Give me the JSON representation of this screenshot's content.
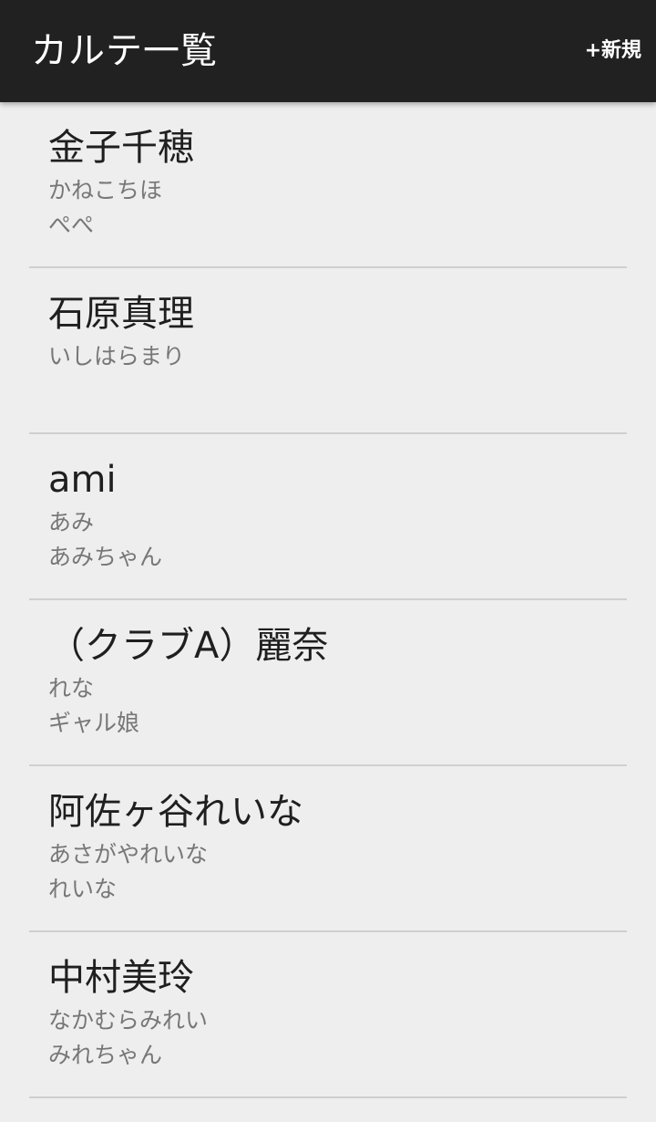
{
  "appbar": {
    "title": "カルテ一覧",
    "new_label": "+新規"
  },
  "records": [
    {
      "name": "金子千穂",
      "kana": "かねこちほ",
      "nickname": "ぺぺ"
    },
    {
      "name": "石原真理",
      "kana": "いしはらまり",
      "nickname": ""
    },
    {
      "name": "ami",
      "kana": "あみ",
      "nickname": "あみちゃん"
    },
    {
      "name": "（クラブA）麗奈",
      "kana": "れな",
      "nickname": "ギャル娘"
    },
    {
      "name": "阿佐ヶ谷れいな",
      "kana": "あさがやれいな",
      "nickname": "れいな"
    },
    {
      "name": "中村美玲",
      "kana": "なかむらみれい",
      "nickname": "みれちゃん"
    }
  ]
}
